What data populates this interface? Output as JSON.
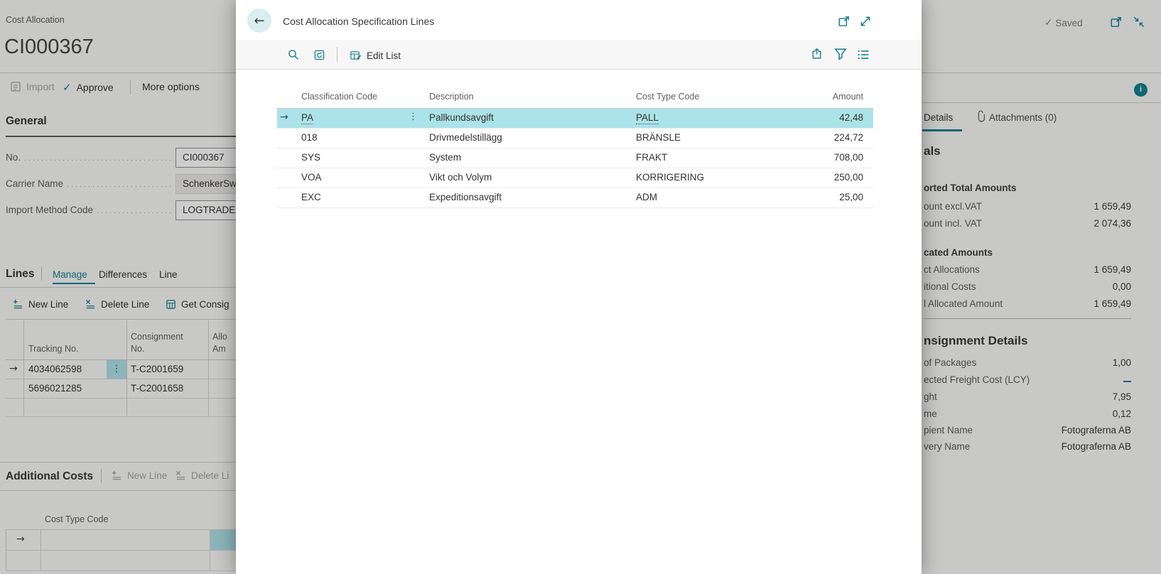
{
  "colors": {
    "accent": "#137e89",
    "selection": "#abe3e9"
  },
  "page": {
    "caption": "Cost Allocation",
    "title": "CI000367",
    "status": {
      "saved": "Saved"
    },
    "actions": {
      "import": "Import",
      "approve": "Approve",
      "more": "More options"
    },
    "general": {
      "heading": "General",
      "fields": [
        {
          "label": "No.",
          "value": "CI000367"
        },
        {
          "label": "Carrier Name",
          "value": "SchenkerSw"
        },
        {
          "label": "Import Method Code",
          "value": "LOGTRADE"
        }
      ]
    },
    "lines": {
      "heading": "Lines",
      "tabs": [
        "Manage",
        "Differences",
        "Line"
      ],
      "actions": [
        "New Line",
        "Delete Line",
        "Get Consig"
      ],
      "columns": {
        "tracking": "Tracking No.",
        "consignment_l1": "Consignment",
        "consignment_l2": "No.",
        "amount_l1": "Allo",
        "amount_l2": "Am"
      },
      "rows": [
        {
          "tracking": "4034062598",
          "consignment": "T-C2001659"
        },
        {
          "tracking": "5696021285",
          "consignment": "T-C2001658"
        }
      ]
    },
    "additional_costs": {
      "heading": "Additional Costs",
      "actions": [
        "New Line",
        "Delete Li"
      ],
      "column": "Cost Type Code"
    }
  },
  "modal": {
    "title": "Cost Allocation Specification Lines",
    "toolbar": {
      "edit_list": "Edit List"
    },
    "table": {
      "columns": [
        "Classification Code",
        "Description",
        "Cost Type Code",
        "Amount"
      ],
      "rows": [
        {
          "code": "PA",
          "description": "Pallkundsavgift",
          "cost_type": "PALL",
          "amount": "42,48"
        },
        {
          "code": "018",
          "description": "Drivmedelstillägg",
          "cost_type": "BRÄNSLE",
          "amount": "224,72"
        },
        {
          "code": "SYS",
          "description": "System",
          "cost_type": "FRAKT",
          "amount": "708,00"
        },
        {
          "code": "VOA",
          "description": "Vikt och Volym",
          "cost_type": "KORRIGERING",
          "amount": "250,00"
        },
        {
          "code": "EXC",
          "description": "Expeditionsavgift",
          "cost_type": "ADM",
          "amount": "25,00"
        }
      ]
    }
  },
  "factbox": {
    "tabs": {
      "details": "Details",
      "attachments": "Attachments (0)"
    },
    "totals_heading": "als",
    "imported": {
      "heading": "orted Total Amounts",
      "rows": [
        {
          "label": "ount excl.VAT",
          "value": "1 659,49"
        },
        {
          "label": "ount incl. VAT",
          "value": "2 074,36"
        }
      ]
    },
    "allocated": {
      "heading": "cated Amounts",
      "rows": [
        {
          "label": "ct Allocations",
          "value": "1 659,49"
        },
        {
          "label": "itional Costs",
          "value": "0,00"
        },
        {
          "label": "l Allocated Amount",
          "value": "1 659,49"
        }
      ]
    },
    "consignment": {
      "heading": "nsignment Details",
      "rows": [
        {
          "label": "of Packages",
          "value": "1,00"
        },
        {
          "label": "ected Freight Cost (LCY)",
          "value": ""
        },
        {
          "label": "ght",
          "value": "7,95"
        },
        {
          "label": "me",
          "value": "0,12"
        },
        {
          "label": "pient Name",
          "value": "Fotograferna AB"
        },
        {
          "label": "very Name",
          "value": "Fotograferna AB"
        }
      ]
    }
  }
}
